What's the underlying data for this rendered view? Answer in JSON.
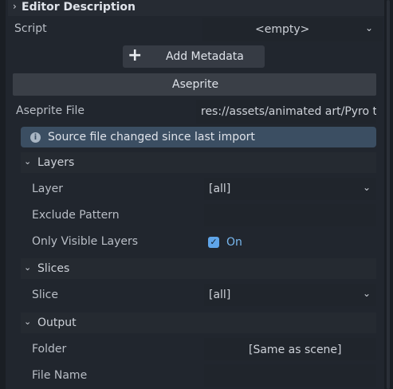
{
  "section": {
    "title": "Editor Description"
  },
  "script": {
    "label": "Script",
    "value": "<empty>"
  },
  "metadata": {
    "add_label": "Add Metadata"
  },
  "aseprite": {
    "header": "Aseprite",
    "file_label": "Aseprite File",
    "file_value": "res://assets/animated art/Pyro t",
    "info_message": "Source file changed since last import"
  },
  "layers": {
    "title": "Layers",
    "layer_label": "Layer",
    "layer_value": "[all]",
    "exclude_label": "Exclude Pattern",
    "exclude_value": "",
    "only_visible_label": "Only Visible Layers",
    "only_visible_value": "On",
    "only_visible_checked": true
  },
  "slices": {
    "title": "Slices",
    "slice_label": "Slice",
    "slice_value": "[all]"
  },
  "output": {
    "title": "Output",
    "folder_label": "Folder",
    "folder_value": "[Same as scene]",
    "filename_label": "File Name",
    "filename_value": ""
  },
  "colors": {
    "background": "#21262e",
    "accent": "#5fa5e9",
    "info_bg": "#3b4e62"
  }
}
